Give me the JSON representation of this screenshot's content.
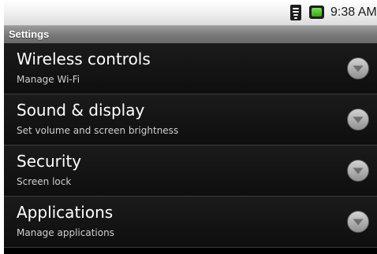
{
  "status_bar": {
    "time": "9:38 AM",
    "icons": [
      "wifi-icon",
      "battery-icon"
    ],
    "battery_color": "#3aa51c"
  },
  "title_bar": {
    "title": "Settings"
  },
  "settings": {
    "items": [
      {
        "title": "Wireless controls",
        "subtitle": "Manage Wi-Fi",
        "icon": "chevron-down-icon"
      },
      {
        "title": "Sound & display",
        "subtitle": "Set volume and screen brightness",
        "icon": "chevron-down-icon"
      },
      {
        "title": "Security",
        "subtitle": "Screen lock",
        "icon": "chevron-down-icon"
      },
      {
        "title": "Applications",
        "subtitle": "Manage applications",
        "icon": "chevron-down-icon"
      }
    ]
  },
  "colors": {
    "background": "#000000",
    "title_bar": "#787878",
    "divider": "#3d3d3d",
    "text_primary": "#ffffff",
    "text_secondary": "#cfcfcf"
  }
}
